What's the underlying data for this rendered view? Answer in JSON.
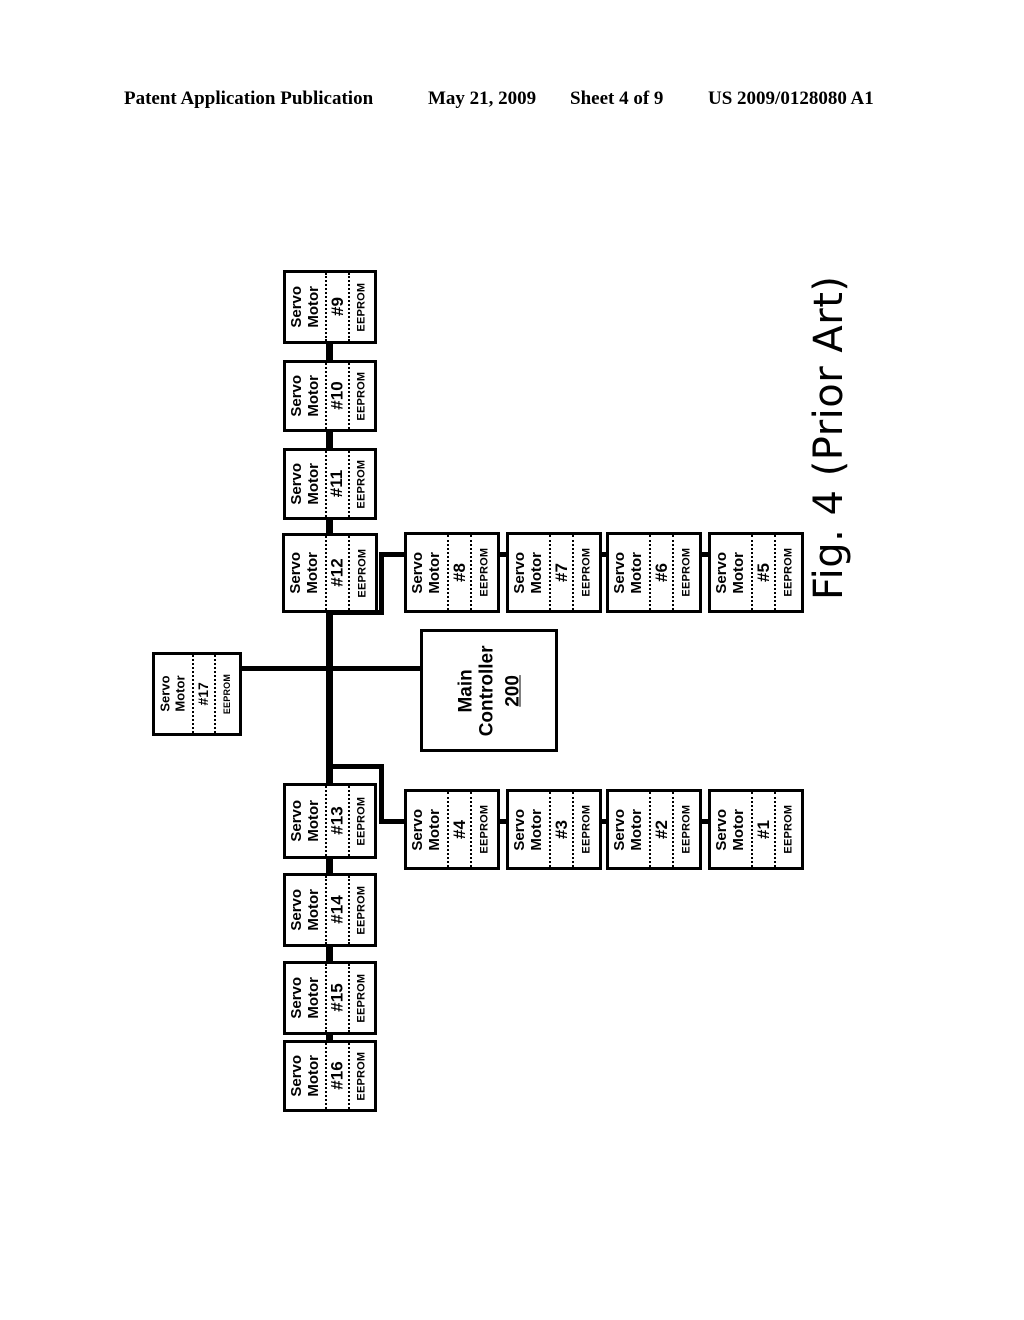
{
  "header": {
    "publication": "Patent Application Publication",
    "date": "May 21, 2009",
    "sheet": "Sheet 4 of 9",
    "number": "US 2009/0128080 A1"
  },
  "figure": {
    "caption": "Fig. 4 (Prior Art)",
    "title_prefix": "Fig. 4",
    "title_suffix": "(Prior Art)"
  },
  "main_controller": {
    "label_line1": "Main",
    "label_line2": "Controller",
    "reference_numeral": "200"
  },
  "block_labels": {
    "name_line1": "Servo",
    "name_line2": "Motor",
    "memory": "EEPROM"
  },
  "chains": {
    "upper_left_column": {
      "description": "vertical daisy-chain above the main bus",
      "blocks": [
        {
          "id": "servo-9",
          "number": "#9",
          "memory": "EEPROM"
        },
        {
          "id": "servo-10",
          "number": "#10",
          "memory": "EEPROM"
        },
        {
          "id": "servo-11",
          "number": "#11",
          "memory": "EEPROM"
        },
        {
          "id": "servo-12",
          "number": "#12",
          "memory": "EEPROM"
        }
      ]
    },
    "upper_right_row": {
      "description": "horizontal daisy-chain branching from servo #12",
      "blocks": [
        {
          "id": "servo-8",
          "number": "#8",
          "memory": "EEPROM"
        },
        {
          "id": "servo-7",
          "number": "#7",
          "memory": "EEPROM"
        },
        {
          "id": "servo-6",
          "number": "#6",
          "memory": "EEPROM"
        },
        {
          "id": "servo-5",
          "number": "#5",
          "memory": "EEPROM"
        }
      ]
    },
    "left_branch": {
      "description": "single servo attached to the bus at the left",
      "blocks": [
        {
          "id": "servo-17",
          "number": "#17",
          "memory": "EEPROM"
        }
      ]
    },
    "lower_left_column": {
      "description": "vertical daisy-chain below the main bus",
      "blocks": [
        {
          "id": "servo-13",
          "number": "#13",
          "memory": "EEPROM"
        },
        {
          "id": "servo-14",
          "number": "#14",
          "memory": "EEPROM"
        },
        {
          "id": "servo-15",
          "number": "#15",
          "memory": "EEPROM"
        },
        {
          "id": "servo-16",
          "number": "#16",
          "memory": "EEPROM"
        }
      ]
    },
    "lower_right_row": {
      "description": "horizontal daisy-chain branching from servo #13",
      "blocks": [
        {
          "id": "servo-4",
          "number": "#4",
          "memory": "EEPROM"
        },
        {
          "id": "servo-3",
          "number": "#3",
          "memory": "EEPROM"
        },
        {
          "id": "servo-2",
          "number": "#2",
          "memory": "EEPROM"
        },
        {
          "id": "servo-1",
          "number": "#1",
          "memory": "EEPROM"
        }
      ]
    }
  },
  "colors": {
    "ink": "#000000",
    "paper": "#ffffff"
  }
}
